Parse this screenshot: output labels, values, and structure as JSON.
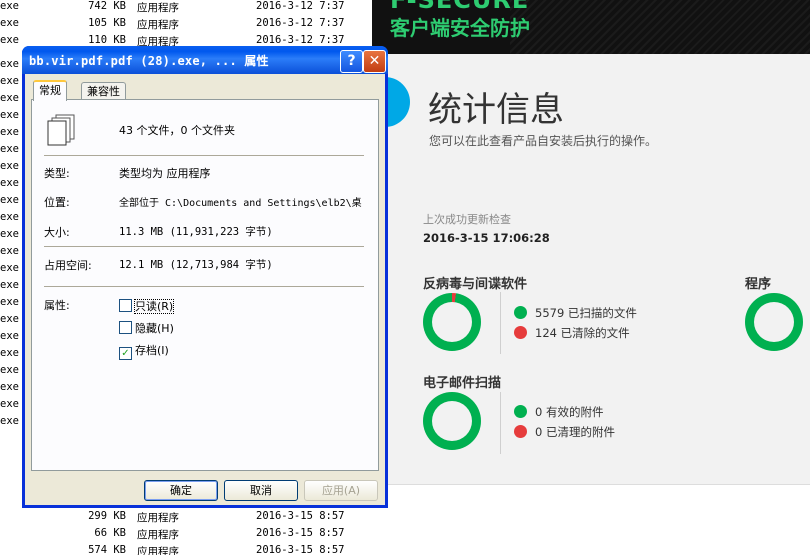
{
  "explorer": {
    "rows_top": [
      {
        "ext": "exe",
        "size": "742 KB",
        "type": "应用程序",
        "date": "2016-3-12 7:37"
      },
      {
        "ext": "exe",
        "size": "105 KB",
        "type": "应用程序",
        "date": "2016-3-12 7:37"
      },
      {
        "ext": "exe",
        "size": "110 KB",
        "type": "应用程序",
        "date": "2016-3-12 7:37"
      }
    ],
    "rows_side": [
      "exe",
      "exe",
      "exe",
      "exe",
      "exe",
      "exe",
      "exe",
      "exe",
      "exe",
      "exe",
      "exe",
      "exe",
      "exe",
      "exe",
      "exe",
      "exe",
      "exe",
      "exe",
      "exe",
      "exe",
      "exe",
      "exe"
    ],
    "rows_bottom": [
      {
        "size": "299 KB",
        "type": "应用程序",
        "date": "2016-3-15 8:57"
      },
      {
        "size": "66 KB",
        "type": "应用程序",
        "date": "2016-3-15 8:57"
      },
      {
        "size": "574 KB",
        "type": "应用程序",
        "date": "2016-3-15 8:57"
      }
    ]
  },
  "fsecure": {
    "brand": "F-SECURE",
    "subtitle": "客户端安全防护",
    "title": "统计信息",
    "description": "您可以在此查看产品自安装后执行的操作。",
    "last_update_label": "上次成功更新检查",
    "last_update_value": "2016-3-15 17:06:28",
    "antivirus": {
      "label": "反病毒与间谍软件",
      "scanned": "5579 已扫描的文件",
      "cleaned": "124 已清除的文件",
      "scanned_fraction": 0.978
    },
    "programs": {
      "label": "程序"
    },
    "email": {
      "label": "电子邮件扫描",
      "valid": "0 有效的附件",
      "cleaned": "0 已清理的附件"
    },
    "colors": {
      "green": "#00b050",
      "red": "#e63c3c",
      "header_green": "#2ecc71",
      "blue": "#00a8e6"
    }
  },
  "dialog": {
    "title": "bb.vir.pdf.pdf (28).exe, ... 属性",
    "help_label": "?",
    "close_label": "✕",
    "tabs": [
      "常规",
      "兼容性"
    ],
    "summary": "43 个文件，0 个文件夹",
    "type_label": "类型:",
    "type_value": "类型均为 应用程序",
    "location_label": "位置:",
    "location_value": "全部位于 C:\\Documents and Settings\\elb2\\桌",
    "size_label": "大小:",
    "size_value": "11.3 MB (11,931,223 字节)",
    "disk_label": "占用空间:",
    "disk_value": "12.1 MB (12,713,984 字节)",
    "attr_label": "属性:",
    "attributes": [
      {
        "label": "只读(R)",
        "checked": false
      },
      {
        "label": "隐藏(H)",
        "checked": false
      },
      {
        "label": "存档(I)",
        "checked": true
      }
    ],
    "ok": "确定",
    "cancel": "取消",
    "apply": "应用(A)"
  }
}
